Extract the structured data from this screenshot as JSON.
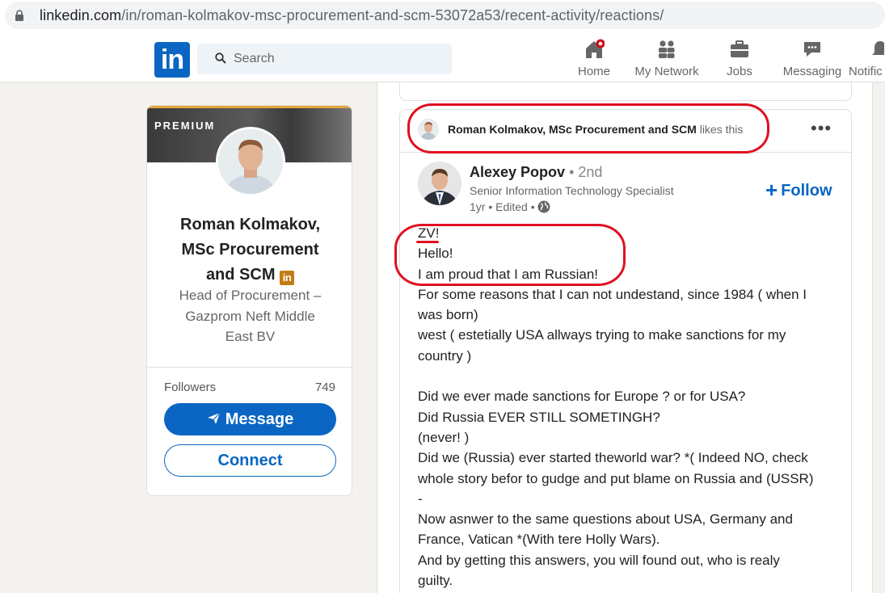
{
  "browser": {
    "url_host": "linkedin.com",
    "url_path": "/in/roman-kolmakov-msc-procurement-and-scm-53072a53/recent-activity/reactions/"
  },
  "nav": {
    "logo": "in",
    "search_placeholder": "Search",
    "items": [
      {
        "label": "Home",
        "icon": "home-icon"
      },
      {
        "label": "My Network",
        "icon": "my-network-icon"
      },
      {
        "label": "Jobs",
        "icon": "jobs-icon"
      },
      {
        "label": "Messaging",
        "icon": "messaging-icon"
      },
      {
        "label": "Notific",
        "icon": "notifications-icon"
      }
    ]
  },
  "profile": {
    "banner_label": "PREMIUM",
    "name": "Roman Kolmakov, MSc Procurement and SCM",
    "premium_badge": "in",
    "headline": "Head of Procurement – Gazprom Neft Middle East BV",
    "followers_label": "Followers",
    "followers_count": "749",
    "message_label": "Message",
    "connect_label": "Connect"
  },
  "post": {
    "activity_actor": "Roman Kolmakov, MSc Procurement and SCM",
    "activity_action": "likes this",
    "more_label": "•••",
    "author_name": "Alexey Popov",
    "author_degree": "• 2nd",
    "author_title": "Senior Information Technology Specialist",
    "author_meta": "1yr • Edited •",
    "follow_label": "Follow",
    "body_lines": [
      "ZV!",
      "Hello!",
      "I am proud that I am Russian!",
      "For some reasons that I can not undestand, since 1984 ( when I",
      "was born)",
      "west ( estetially USA allways trying to make sanctions for my",
      "country )",
      "",
      "Did we ever made sanctions for Europe ? or for USA?",
      "Did Russia EVER STILL SOMETINGH?",
      "(never! )",
      "Did we (Russia) ever started theworld war? *( Indeed NO, check",
      "whole story befor to gudge and put blame on Russia and (USSR)",
      "-",
      "Now asnwer to the same questions about USA, Germany and",
      "France, Vatican *(With tere Holly Wars).",
      "And by getting this answers, you will found out, who is realy",
      "guilty."
    ]
  },
  "colors": {
    "brand_blue": "#0a66c2",
    "annotation_red": "#e01020",
    "premium_gold": "#c37d16",
    "page_bg": "#f3f2ef"
  }
}
